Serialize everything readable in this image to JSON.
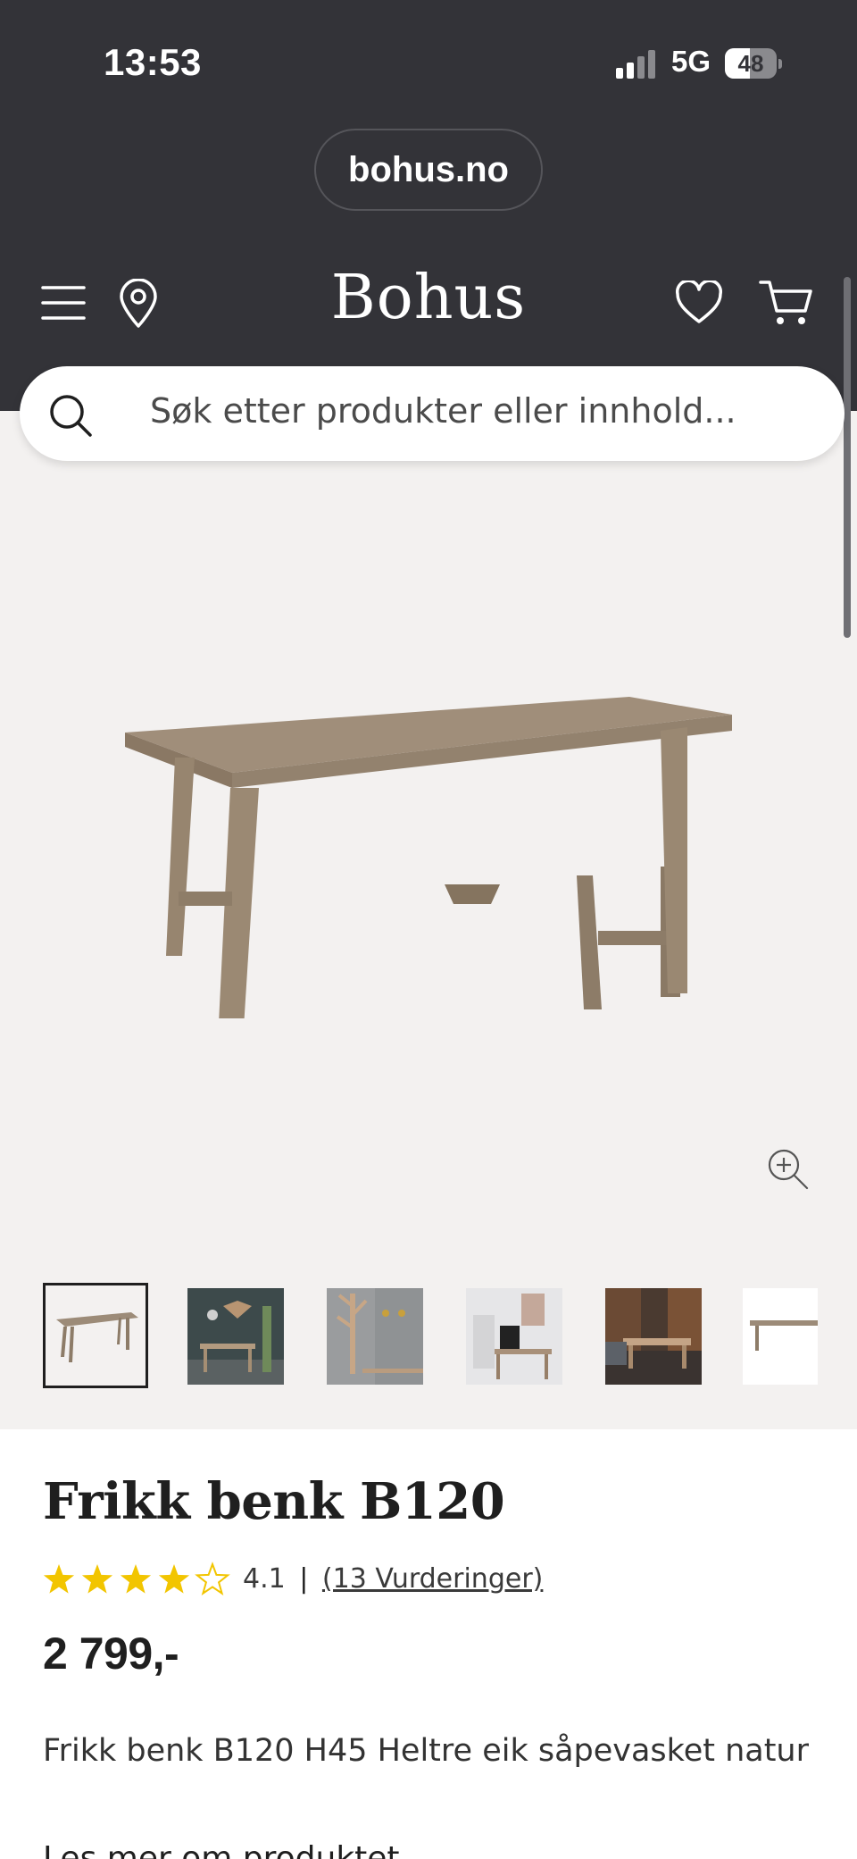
{
  "status_bar": {
    "time": "13:53",
    "network": "5G",
    "battery": "48",
    "battery_level": 0.48
  },
  "browser": {
    "url": "bohus.no"
  },
  "header": {
    "logo": "Bohus"
  },
  "search": {
    "placeholder": "Søk etter produkter eller innhold..."
  },
  "gallery": {
    "thumbnails": [
      "thumb-bench",
      "thumb-entry-wall",
      "thumb-coat-rack",
      "thumb-hallway",
      "thumb-dining-room",
      "thumb-bench-partial"
    ],
    "active_index": 0
  },
  "product": {
    "title": "Frikk benk B120",
    "rating_value": "4.1",
    "rating_stars": 4.1,
    "rating_separator": "|",
    "reviews_link": "(13 Vurderinger)",
    "price": "2 799,-",
    "description": "Frikk benk B120 H45 Heltre eik såpevasket natur",
    "next_heading_partial": "Les mer om produktet"
  },
  "colors": {
    "header_bg": "#333338",
    "gallery_bg": "#f3f1f0",
    "star": "#f2c500",
    "wood": "#9c8b78"
  }
}
